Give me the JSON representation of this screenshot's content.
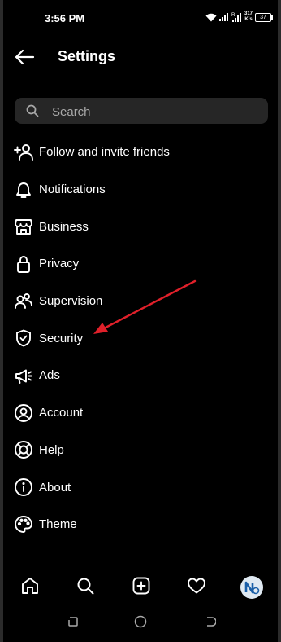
{
  "status_bar": {
    "time": "3:56 PM",
    "net_speed_value": "317",
    "net_speed_unit": "K/s",
    "battery": "37",
    "icons": [
      "wifi-icon",
      "signal-icon",
      "roaming-signal-icon"
    ]
  },
  "header": {
    "title": "Settings",
    "back_icon": "arrow-left-icon"
  },
  "search": {
    "placeholder": "Search",
    "value": "",
    "icon": "search-icon"
  },
  "menu": {
    "items": [
      {
        "label": "Follow and invite friends",
        "icon": "add-person-icon"
      },
      {
        "label": "Notifications",
        "icon": "bell-icon"
      },
      {
        "label": "Business",
        "icon": "shop-icon"
      },
      {
        "label": "Privacy",
        "icon": "lock-icon"
      },
      {
        "label": "Supervision",
        "icon": "people-icon"
      },
      {
        "label": "Security",
        "icon": "shield-check-icon"
      },
      {
        "label": "Ads",
        "icon": "megaphone-icon"
      },
      {
        "label": "Account",
        "icon": "account-circle-icon"
      },
      {
        "label": "Help",
        "icon": "lifebuoy-icon"
      },
      {
        "label": "About",
        "icon": "info-icon"
      },
      {
        "label": "Theme",
        "icon": "palette-icon"
      }
    ]
  },
  "annotation": {
    "type": "arrow",
    "color": "#e0202a",
    "points_to": "Security"
  },
  "bottom_nav": {
    "items": [
      "home-icon",
      "search-icon",
      "create-post-icon",
      "heart-icon",
      "profile-avatar"
    ]
  },
  "system_nav": {
    "items": [
      "recent-apps-icon",
      "home-circle-icon",
      "back-icon"
    ]
  },
  "colors": {
    "background": "#000000",
    "search_bg": "#262626",
    "text": "#ffffff",
    "placeholder": "#a8a8a8",
    "arrow": "#e0202a"
  }
}
